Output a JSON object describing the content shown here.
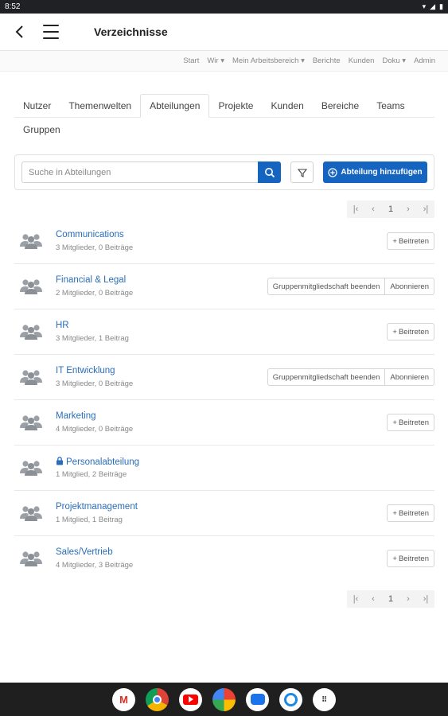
{
  "status": {
    "time": "8:52"
  },
  "appbar": {
    "title": "Verzeichnisse"
  },
  "topnav": [
    {
      "label": "Start"
    },
    {
      "label": "Wir ▾"
    },
    {
      "label": "Mein Arbeitsbereich ▾"
    },
    {
      "label": "Berichte"
    },
    {
      "label": "Kunden"
    },
    {
      "label": "Doku ▾"
    },
    {
      "label": "Admin"
    }
  ],
  "tabs": {
    "row1": [
      "Nutzer",
      "Themenwelten",
      "Abteilungen",
      "Projekte",
      "Kunden",
      "Bereiche",
      "Teams"
    ],
    "row2": [
      "Gruppen"
    ],
    "active": "Abteilungen"
  },
  "search": {
    "placeholder": "Suche in Abteilungen",
    "add_label": "Abteilung hinzufügen"
  },
  "pager": {
    "current": "1"
  },
  "labels": {
    "join": "Beitreten",
    "leave": "Gruppenmitgliedschaft beenden",
    "subscribe": "Abonnieren"
  },
  "groups": [
    {
      "name": "Communications",
      "meta": "3 Mitglieder, 0 Beiträge",
      "action": "join",
      "locked": false
    },
    {
      "name": "Financial & Legal",
      "meta": "2 Mitglieder, 0 Beiträge",
      "action": "member",
      "locked": false
    },
    {
      "name": "HR",
      "meta": "3 Mitglieder, 1 Beitrag",
      "action": "join",
      "locked": false
    },
    {
      "name": "IT Entwicklung",
      "meta": "3 Mitglieder, 0 Beiträge",
      "action": "member",
      "locked": false
    },
    {
      "name": "Marketing",
      "meta": "4 Mitglieder, 0 Beiträge",
      "action": "join",
      "locked": false
    },
    {
      "name": "Personalabteilung",
      "meta": "1 Mitglied, 2 Beiträge",
      "action": "none",
      "locked": true
    },
    {
      "name": "Projektmanagement",
      "meta": "1 Mitglied, 1 Beitrag",
      "action": "join",
      "locked": false
    },
    {
      "name": "Sales/Vertrieb",
      "meta": "4 Mitglieder, 3 Beiträge",
      "action": "join",
      "locked": false
    }
  ],
  "dock": [
    "gmail-icon",
    "chrome-icon",
    "youtube-icon",
    "photos-icon",
    "messages-icon",
    "browser-icon",
    "apps-icon"
  ],
  "colors": {
    "primary": "#1565c0",
    "link": "#2a6db8"
  }
}
